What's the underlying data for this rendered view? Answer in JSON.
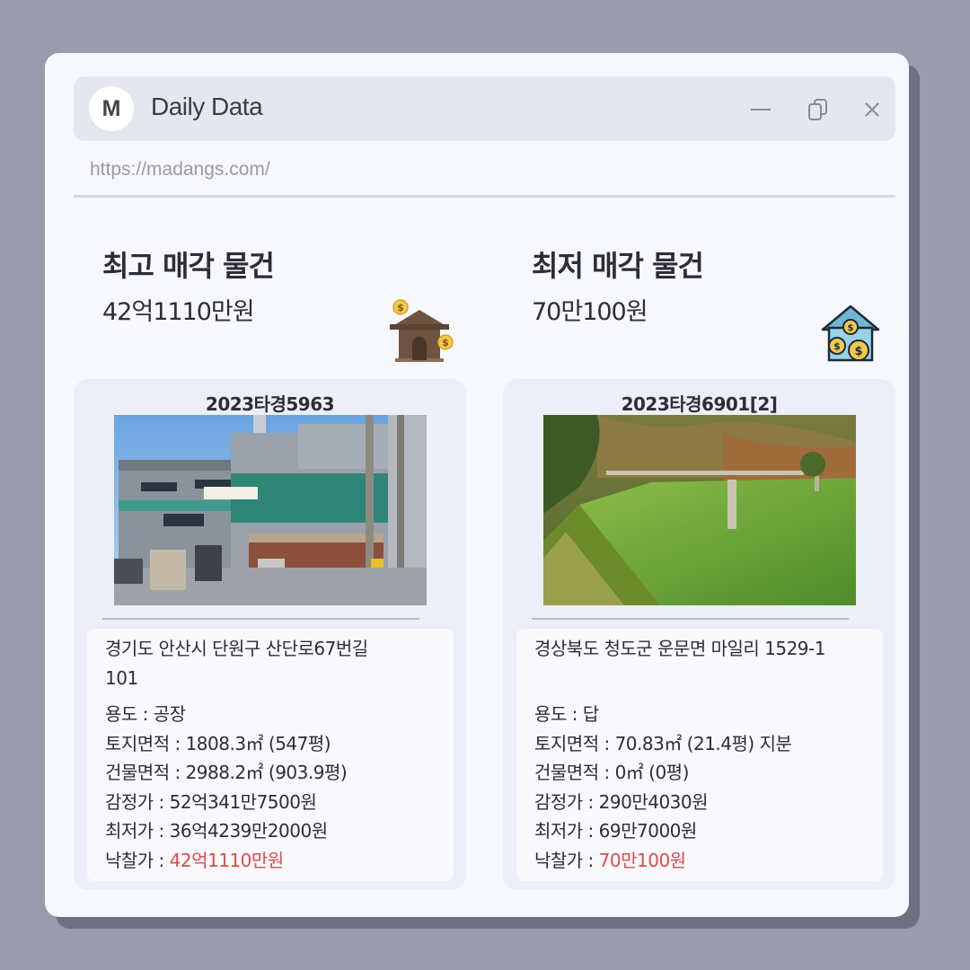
{
  "window": {
    "logo_letter": "M",
    "title": "Daily Data",
    "url": "https://madangs.com/"
  },
  "highest": {
    "heading": "최고 매각 물건",
    "price": "42억1110만원",
    "icon": "house-money-icon",
    "case_no": "2023타경5963",
    "photo": "factory-building-photo",
    "address": "경기도 안산시 단원구 산단로67번길 101",
    "usage_label": "용도 : ",
    "usage": "공장",
    "land_label": "토지면적 : ",
    "land_area": "1808.3㎡ (547평)",
    "building_label": "건물면적 : ",
    "building_area": "2988.2㎡ (903.9평)",
    "appraisal_label": "감정가 : ",
    "appraisal": "52억341만7500원",
    "minimum_label": "최저가 : ",
    "minimum": "36억4239만2000원",
    "winning_label": "낙찰가 : ",
    "winning": "42억1110만원"
  },
  "lowest": {
    "heading": "최저 매각 물건",
    "price": "70만100원",
    "icon": "house-coins-icon",
    "case_no": "2023타경6901[2]",
    "photo": "grass-field-photo",
    "address": "경상북도 청도군 운문면 마일리 1529-1",
    "usage_label": "용도 : ",
    "usage": "답",
    "land_label": "토지면적 : ",
    "land_area": "70.83㎡ (21.4평) 지분",
    "building_label": "건물면적 : ",
    "building_area": "0㎡ (0평)",
    "appraisal_label": "감정가 : ",
    "appraisal": "290만4030원",
    "minimum_label": "최저가 : ",
    "minimum": "69만7000원",
    "winning_label": "낙찰가 : ",
    "winning": "70만100원"
  },
  "colors": {
    "background": "#9a9cae",
    "window": "#f7f8fd",
    "titlebar": "#e5e7ef",
    "card": "#eceef8",
    "highlight": "#e04a45"
  }
}
